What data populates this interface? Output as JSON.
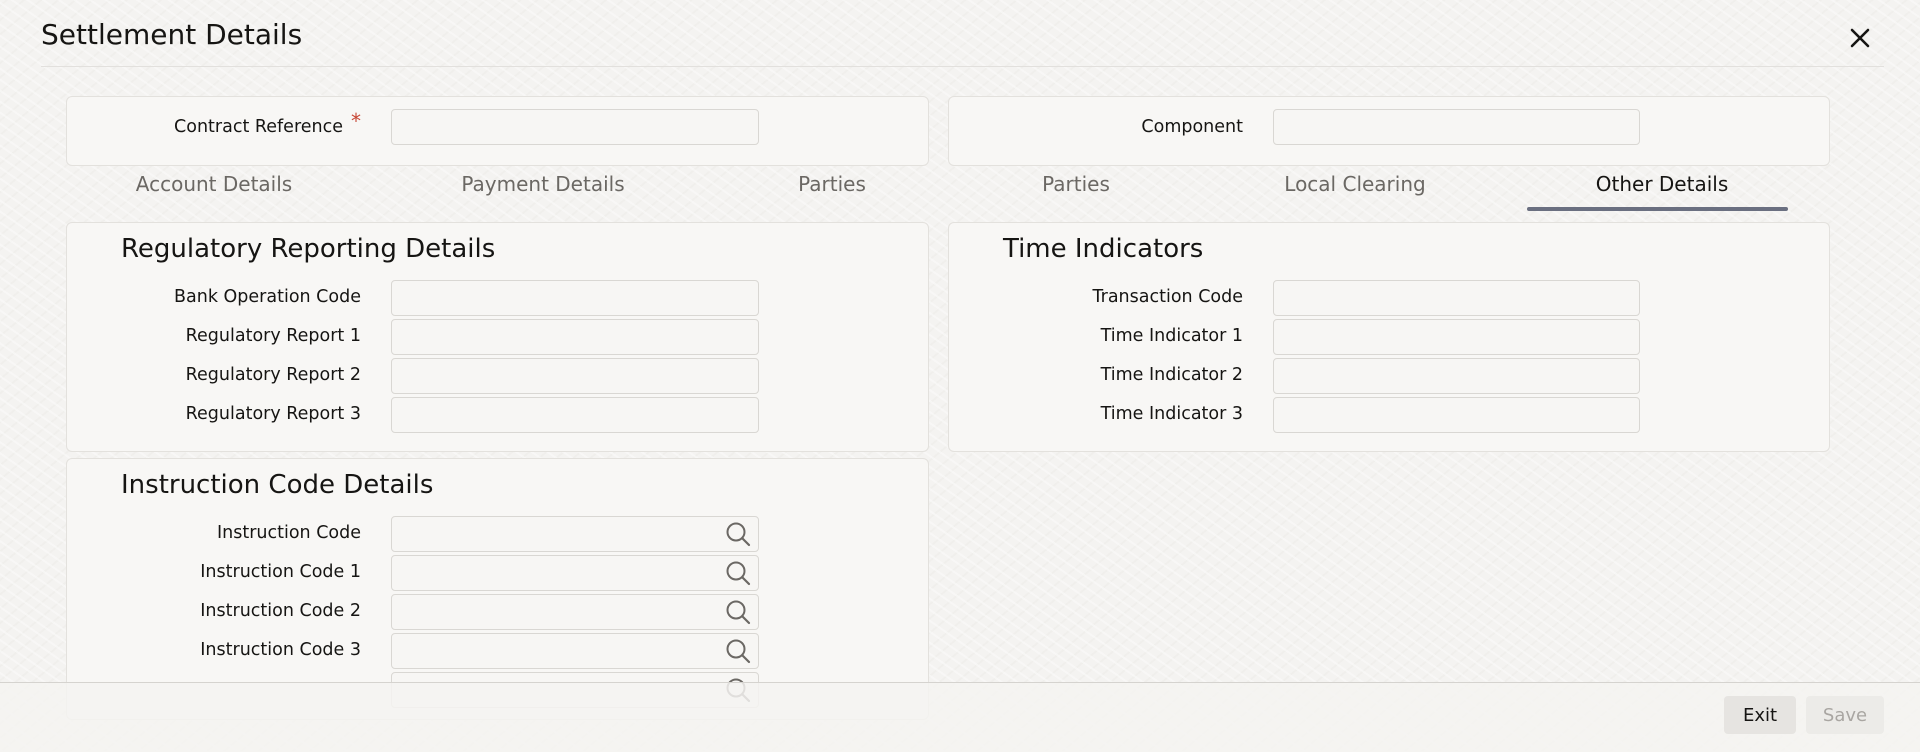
{
  "window": {
    "title": "Settlement Details"
  },
  "header": {
    "contract_reference_label": "Contract Reference",
    "required_mark": "*",
    "contract_reference_value": "",
    "component_label": "Component",
    "component_value": ""
  },
  "tabs": [
    {
      "label": "Account Details",
      "active": false
    },
    {
      "label": "Payment Details",
      "active": false
    },
    {
      "label": "Parties",
      "active": false
    },
    {
      "label": "Parties",
      "active": false
    },
    {
      "label": "Local Clearing",
      "active": false
    },
    {
      "label": "Other Details",
      "active": true
    }
  ],
  "regulatory": {
    "heading": "Regulatory Reporting Details",
    "fields": [
      {
        "label": "Bank Operation Code",
        "value": ""
      },
      {
        "label": "Regulatory Report 1",
        "value": ""
      },
      {
        "label": "Regulatory Report 2",
        "value": ""
      },
      {
        "label": "Regulatory Report 3",
        "value": ""
      }
    ]
  },
  "time": {
    "heading": "Time Indicators",
    "fields": [
      {
        "label": "Transaction Code",
        "value": ""
      },
      {
        "label": "Time Indicator 1",
        "value": ""
      },
      {
        "label": "Time Indicator 2",
        "value": ""
      },
      {
        "label": "Time Indicator 3",
        "value": ""
      }
    ]
  },
  "instruction": {
    "heading": "Instruction Code Details",
    "fields": [
      {
        "label": "Instruction Code",
        "value": ""
      },
      {
        "label": "Instruction Code 1",
        "value": ""
      },
      {
        "label": "Instruction Code 2",
        "value": ""
      },
      {
        "label": "Instruction Code 3",
        "value": ""
      },
      {
        "label": "",
        "value": ""
      }
    ]
  },
  "icons": {
    "close": "close-icon",
    "lookup": "search-icon"
  },
  "footer": {
    "exit_label": "Exit",
    "save_label": "Save"
  },
  "colors": {
    "accent": "#6a6f80",
    "required": "#c74634"
  }
}
